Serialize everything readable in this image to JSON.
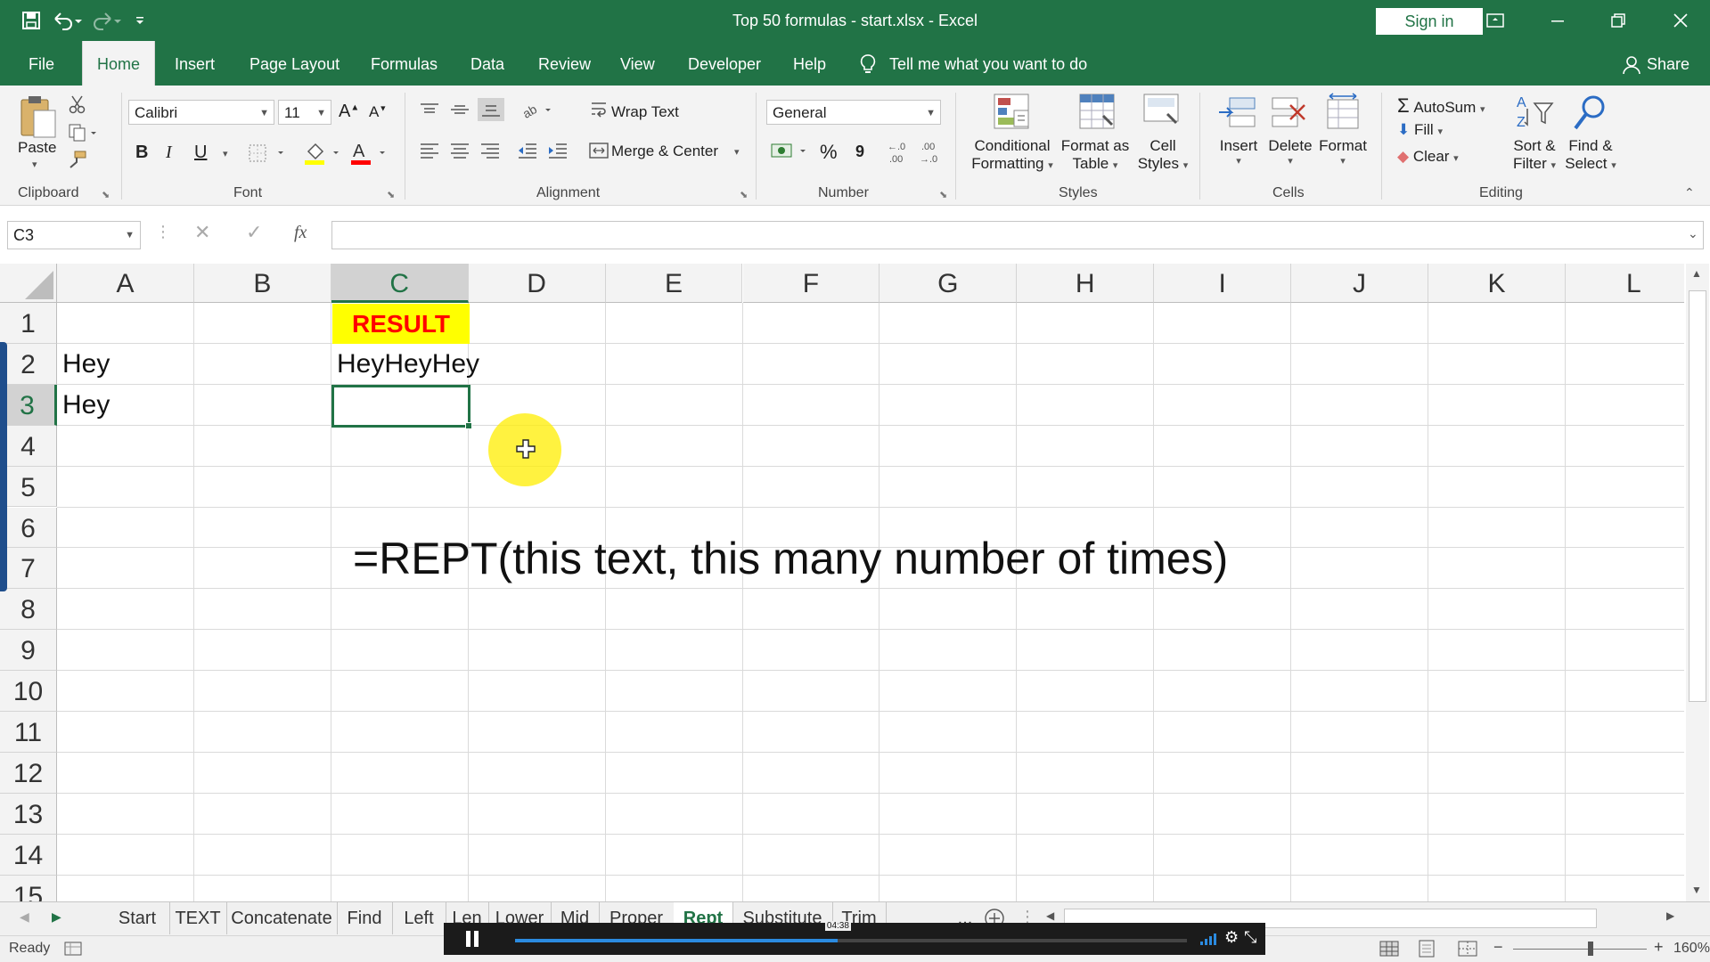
{
  "window": {
    "title": "Top 50 formulas - start.xlsx  -  Excel",
    "sign_in": "Sign in"
  },
  "menu": {
    "tabs": [
      "File",
      "Home",
      "Insert",
      "Page Layout",
      "Formulas",
      "Data",
      "Review",
      "View",
      "Developer",
      "Help"
    ],
    "active_tab": "Home",
    "tell_me": "Tell me what you want to do",
    "share": "Share"
  },
  "ribbon": {
    "clipboard": {
      "label": "Clipboard",
      "paste": "Paste"
    },
    "font": {
      "label": "Font",
      "name": "Calibri",
      "size": "11",
      "bold": "B",
      "italic": "I",
      "underline": "U"
    },
    "alignment": {
      "label": "Alignment",
      "wrap_text": "Wrap Text",
      "merge_center": "Merge & Center"
    },
    "number": {
      "label": "Number",
      "format": "General",
      "percent": "%",
      "comma": "9",
      "inc_decimal": "+.0\n.00",
      "dec_decimal": ".00\n→.0"
    },
    "styles": {
      "label": "Styles",
      "conditional": "Conditional",
      "formatting": "Formatting",
      "format_as": "Format as",
      "table": "Table",
      "cell": "Cell",
      "cell_styles": "Styles"
    },
    "cells": {
      "label": "Cells",
      "insert": "Insert",
      "delete": "Delete",
      "format": "Format"
    },
    "editing": {
      "label": "Editing",
      "autosum": "AutoSum",
      "fill": "Fill",
      "clear": "Clear",
      "sort": "Sort &",
      "filter": "Filter",
      "find": "Find &",
      "select": "Select"
    }
  },
  "formula_bar": {
    "name_box": "C3",
    "fx": "fx",
    "value": ""
  },
  "grid": {
    "columns": [
      "A",
      "B",
      "C",
      "D",
      "E",
      "F",
      "G",
      "H",
      "I",
      "J",
      "K",
      "L"
    ],
    "rows": [
      "1",
      "2",
      "3",
      "4",
      "5",
      "6",
      "7",
      "8",
      "9",
      "10",
      "11",
      "12",
      "13",
      "14",
      "15"
    ],
    "selected_column": "C",
    "selected_row": "3",
    "cells": {
      "C1": "RESULT",
      "A2": "Hey",
      "C2": "HeyHeyHey",
      "A3": "Hey"
    },
    "note": "=REPT(this text, this many number of times)"
  },
  "sheets": {
    "tabs": [
      "Start",
      "TEXT",
      "Concatenate",
      "Find",
      "Left",
      "Len",
      "Lower",
      "Mid",
      "Proper",
      "Rept",
      "Substitute",
      "Trim"
    ],
    "active": "Rept",
    "more": "..."
  },
  "status": {
    "ready": "Ready",
    "zoom": "160%",
    "video_time": "04:38",
    "video_progress": 0.48
  },
  "colors": {
    "excel_green": "#217346",
    "result_fill": "#ffff00",
    "result_text": "#ff0000"
  }
}
